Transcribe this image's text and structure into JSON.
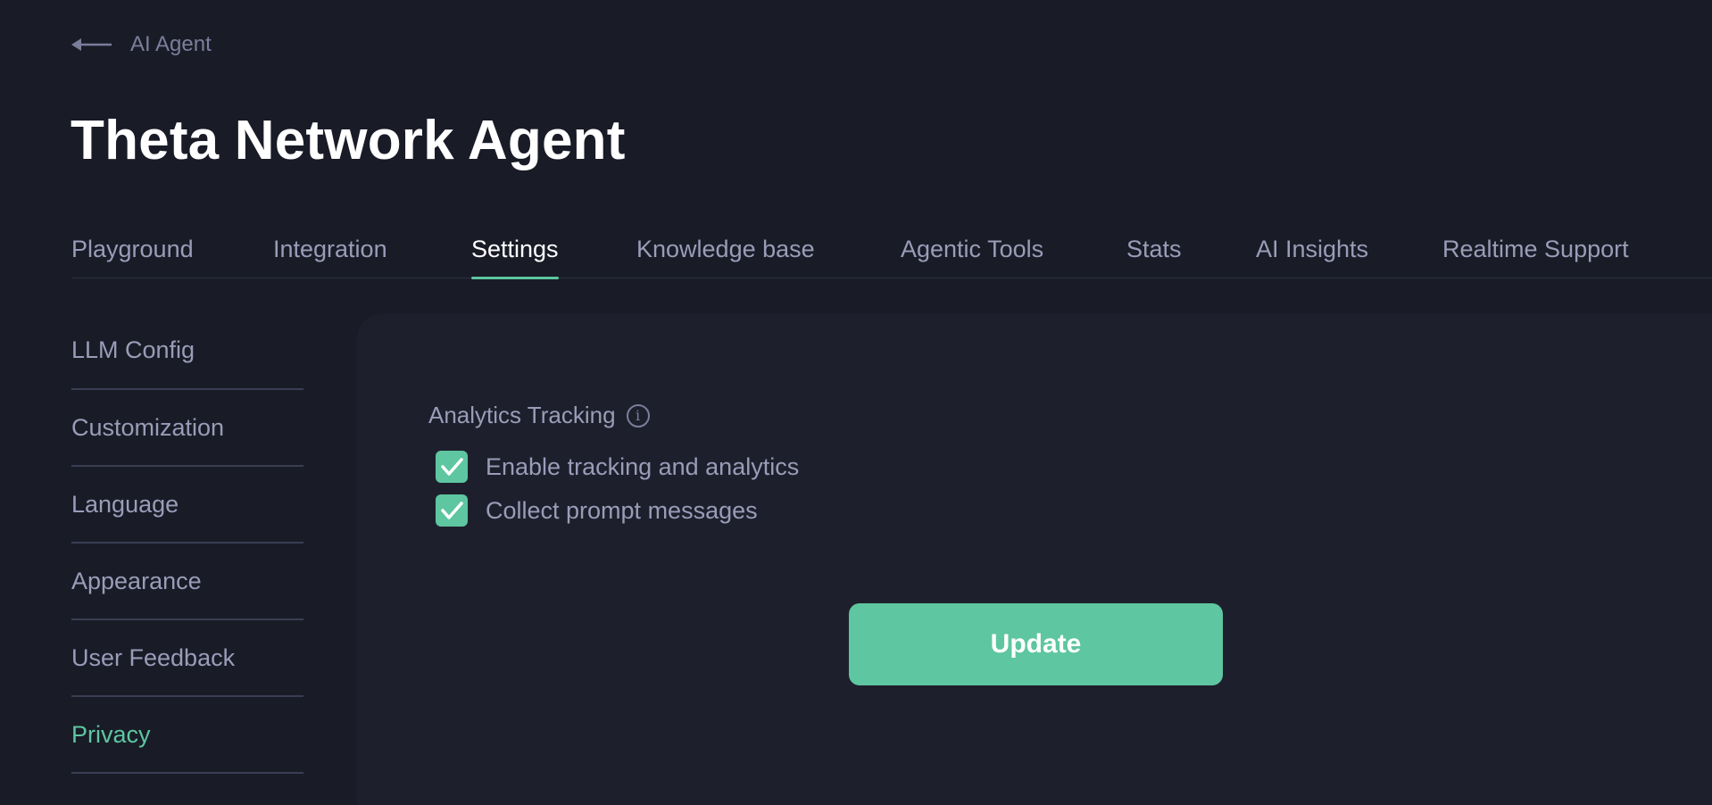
{
  "breadcrumb": {
    "back_label": "AI Agent"
  },
  "page_title": "Theta Network Agent",
  "tabs": [
    {
      "label": "Playground"
    },
    {
      "label": "Integration"
    },
    {
      "label": "Settings",
      "active": true
    },
    {
      "label": "Knowledge base"
    },
    {
      "label": "Agentic Tools"
    },
    {
      "label": "Stats"
    },
    {
      "label": "AI Insights"
    },
    {
      "label": "Realtime Support"
    }
  ],
  "sidebar": {
    "items": [
      {
        "label": "LLM Config"
      },
      {
        "label": "Customization"
      },
      {
        "label": "Language"
      },
      {
        "label": "Appearance"
      },
      {
        "label": "User Feedback"
      },
      {
        "label": "Privacy",
        "active": true
      }
    ]
  },
  "privacy": {
    "section_label": "Analytics Tracking",
    "info_icon": "i",
    "options": [
      {
        "label": "Enable tracking and analytics",
        "checked": true
      },
      {
        "label": "Collect prompt messages",
        "checked": true
      }
    ],
    "update_label": "Update"
  },
  "colors": {
    "background": "#191c27",
    "panel": "#1d202c",
    "accent": "#5ec6a0",
    "text_muted": "#9a9cb8",
    "text_primary": "#ffffff"
  }
}
